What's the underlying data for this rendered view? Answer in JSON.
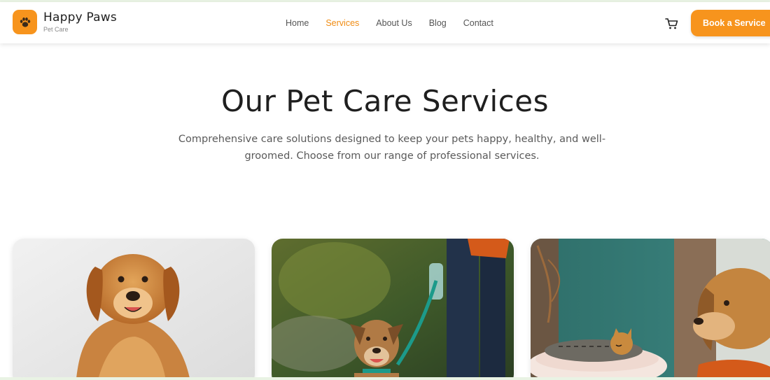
{
  "brand": {
    "name": "Happy Paws",
    "tagline": "Pet Care",
    "logo_icon": "paw-icon",
    "accent_color": "#f7941d"
  },
  "nav": {
    "items": [
      {
        "label": "Home",
        "active": false
      },
      {
        "label": "Services",
        "active": true
      },
      {
        "label": "About Us",
        "active": false
      },
      {
        "label": "Blog",
        "active": false
      },
      {
        "label": "Contact",
        "active": false
      }
    ],
    "cart_icon": "cart-icon",
    "cta_label": "Book a Service"
  },
  "hero": {
    "title": "Our Pet Care Services",
    "description": "Comprehensive care solutions designed to keep your pets happy, healthy, and well-groomed. Choose from our range of professional services."
  },
  "cards": [
    {
      "image": "golden-retriever-photo"
    },
    {
      "image": "dog-walking-photo"
    },
    {
      "image": "cat-and-dog-photo"
    }
  ]
}
